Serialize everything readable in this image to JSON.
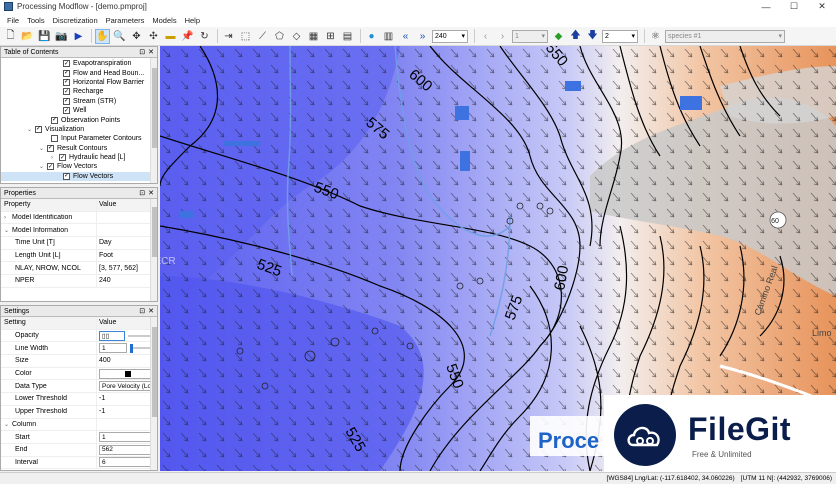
{
  "window": {
    "title": "Processing Modflow - [demo.pmproj]",
    "minimize": "—",
    "maximize": "☐",
    "close": "✕"
  },
  "menu": [
    "File",
    "Tools",
    "Discretization",
    "Parameters",
    "Models",
    "Help"
  ],
  "toolbar": {
    "layer_combo": "240",
    "species_index": "1",
    "layer_index": "2",
    "species": "species #1"
  },
  "toc": {
    "title": "Table of Contents",
    "items": [
      {
        "label": "Evapotranspiration",
        "checked": true
      },
      {
        "label": "Flow and Head Boun...",
        "checked": true
      },
      {
        "label": "Horizontal Flow Barrier",
        "checked": true
      },
      {
        "label": "Recharge",
        "checked": true
      },
      {
        "label": "Stream (STR)",
        "checked": true
      },
      {
        "label": "Well",
        "checked": true
      },
      {
        "label": "Observation Points",
        "checked": true
      },
      {
        "label": "Visualization",
        "checked": true
      },
      {
        "label": "Input Parameter Contours",
        "checked": false
      },
      {
        "label": "Result Contours",
        "checked": true
      },
      {
        "label": "Hydraulic head [L]",
        "checked": true
      },
      {
        "label": "Flow Vectors",
        "checked": true
      },
      {
        "label": "Flow Vectors",
        "checked": true
      }
    ]
  },
  "properties": {
    "title": "Properties",
    "col_property": "Property",
    "col_value": "Value",
    "rows": [
      {
        "k": "Model Identification",
        "v": "",
        "cat": true
      },
      {
        "k": "Model Information",
        "v": "",
        "cat": true
      },
      {
        "k": "Time Unit [T]",
        "v": "Day"
      },
      {
        "k": "Length Unit [L]",
        "v": "Foot"
      },
      {
        "k": "NLAY, NROW, NCOL",
        "v": "[3, 577, 562]"
      },
      {
        "k": "NPER",
        "v": "240"
      }
    ]
  },
  "settings": {
    "title": "Settings",
    "col_setting": "Setting",
    "col_value": "Value",
    "rows": [
      {
        "k": "Opacity",
        "v": ""
      },
      {
        "k": "Line Width",
        "v": "1"
      },
      {
        "k": "Size",
        "v": "400"
      },
      {
        "k": "Color",
        "v": ""
      },
      {
        "k": "Data Type",
        "v": "Pore Velocity (Log)"
      },
      {
        "k": "Lower Threshold",
        "v": "-1"
      },
      {
        "k": "Upper Threshold",
        "v": "-1"
      },
      {
        "k": "Column",
        "v": ""
      },
      {
        "k": "Start",
        "v": "1"
      },
      {
        "k": "End",
        "v": "562"
      },
      {
        "k": "Interval",
        "v": "6"
      }
    ]
  },
  "map": {
    "contour_labels": [
      "600",
      "575",
      "550",
      "525",
      "550",
      "575",
      "600",
      "525",
      "550"
    ],
    "road_label": "Camino Real",
    "route": "60",
    "town": "Limo",
    "overlay_text": "Proce",
    "watermark": "FILECR"
  },
  "status": {
    "coords": "[WGS84] Lng/Lat: (-117.618402, 34.060226)",
    "utm": "[UTM 11 N]: (442932, 3769006)"
  },
  "badge": {
    "name": "FileGit",
    "tagline": "Free & Unlimited"
  },
  "colors": {
    "blue_dark": "#5a5ef0",
    "blue_light": "#dfe0fb",
    "orange": "#e8935b",
    "panel_header": "#eaeaea"
  }
}
